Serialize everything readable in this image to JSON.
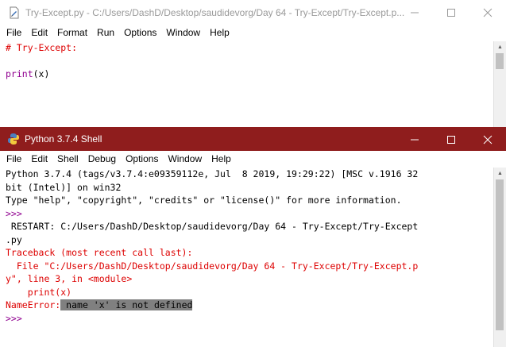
{
  "editor": {
    "title": "Try-Except.py - C:/Users/DashD/Desktop/saudidevorg/Day 64 - Try-Except/Try-Except.p...",
    "menu": [
      "File",
      "Edit",
      "Format",
      "Run",
      "Options",
      "Window",
      "Help"
    ],
    "code": {
      "line1": "# Try-Except:",
      "line3_func": "print",
      "line3_rest": "(x)"
    }
  },
  "shell": {
    "title": "Python 3.7.4 Shell",
    "menu": [
      "File",
      "Edit",
      "Shell",
      "Debug",
      "Options",
      "Window",
      "Help"
    ],
    "output": {
      "l1": "Python 3.7.4 (tags/v3.7.4:e09359112e, Jul  8 2019, 19:29:22) [MSC v.1916 32",
      "l2": "bit (Intel)] on win32",
      "l3": "Type \"help\", \"copyright\", \"credits\" or \"license()\" for more information.",
      "prompt": ">>>",
      "restart1": " RESTART: C:/Users/DashD/Desktop/saudidevorg/Day 64 - Try-Except/Try-Except",
      "restart2": ".py",
      "tb1": "Traceback (most recent call last):",
      "tb2": "  File \"C:/Users/DashD/Desktop/saudidevorg/Day 64 - Try-Except/Try-Except.p",
      "tb3": "y\", line 3, in <module>",
      "tb4": "    print(x)",
      "err_label": "NameError:",
      "err_msg": " name 'x' is not defined",
      "prompt2": ">>>"
    }
  },
  "colors": {
    "shell_titlebar": "#8f1d1d",
    "error_red": "#dd0000",
    "builtin_purple": "#900090"
  }
}
